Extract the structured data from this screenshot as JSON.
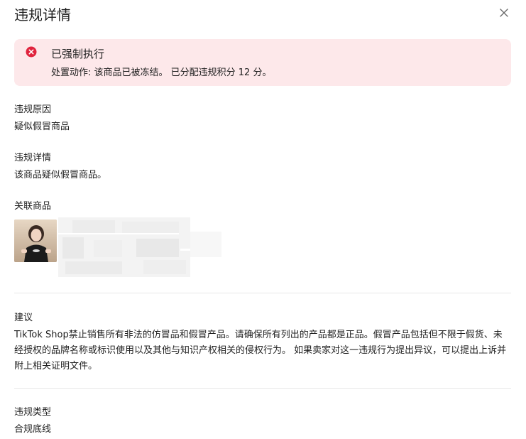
{
  "dialog": {
    "title": "违规详情",
    "close_icon": "close-icon"
  },
  "alert": {
    "icon": "error-circle-icon",
    "color": "#e0233d",
    "background": "#fde8ea",
    "title": "已强制执行",
    "body": "处置动作: 该商品已被冻结。 已分配违规积分 12 分。"
  },
  "sections": {
    "reason": {
      "label": "违规原因",
      "value": "疑似假冒商品"
    },
    "details": {
      "label": "违规详情",
      "value": "该商品疑似假冒商品。"
    },
    "product": {
      "label": "关联商品"
    },
    "advice": {
      "label": "建议",
      "value": "TikTok Shop禁止销售所有非法的仿冒品和假冒产品。请确保所有列出的产品都是正品。假冒产品包括但不限于假货、未经授权的品牌名称或标识使用以及其他与知识产权相关的侵权行为。 如果卖家对这一违规行为提出异议，可以提出上诉并附上相关证明文件。"
    },
    "type": {
      "label": "违规类型",
      "value": "合规底线"
    }
  }
}
